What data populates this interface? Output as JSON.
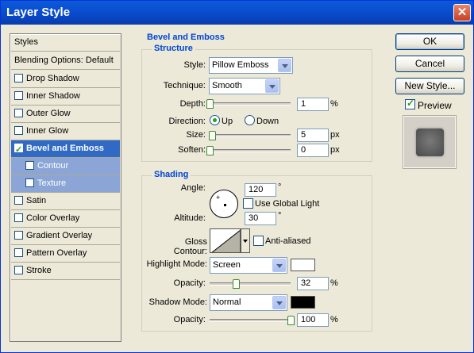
{
  "window": {
    "title": "Layer Style"
  },
  "style_list": {
    "header": "Styles",
    "blending": "Blending Options: Default",
    "items": [
      {
        "label": "Drop Shadow",
        "checked": false
      },
      {
        "label": "Inner Shadow",
        "checked": false
      },
      {
        "label": "Outer Glow",
        "checked": false
      },
      {
        "label": "Inner Glow",
        "checked": false
      },
      {
        "label": "Bevel and Emboss",
        "checked": true,
        "selected": true
      },
      {
        "label": "Contour",
        "checked": false,
        "sub": true
      },
      {
        "label": "Texture",
        "checked": false,
        "sub": true
      },
      {
        "label": "Satin",
        "checked": false
      },
      {
        "label": "Color Overlay",
        "checked": false
      },
      {
        "label": "Gradient Overlay",
        "checked": false
      },
      {
        "label": "Pattern Overlay",
        "checked": false
      },
      {
        "label": "Stroke",
        "checked": false
      }
    ]
  },
  "bevel": {
    "section_title": "Bevel and Emboss",
    "structure": {
      "legend": "Structure",
      "style_label": "Style:",
      "style_value": "Pillow Emboss",
      "technique_label": "Technique:",
      "technique_value": "Smooth",
      "depth_label": "Depth:",
      "depth_value": "1",
      "depth_unit": "%",
      "depth_level": 0.0,
      "direction_label": "Direction:",
      "direction_up": "Up",
      "direction_down": "Down",
      "direction_selected": "Up",
      "size_label": "Size:",
      "size_value": "5",
      "size_unit": "px",
      "size_level": 0.03,
      "soften_label": "Soften:",
      "soften_value": "0",
      "soften_unit": "px",
      "soften_level": 0.0
    },
    "shading": {
      "legend": "Shading",
      "angle_label": "Angle:",
      "angle_value": "120",
      "degree": "°",
      "global_light_label": "Use Global Light",
      "global_light_checked": false,
      "altitude_label": "Altitude:",
      "altitude_value": "30",
      "gloss_label": "Gloss Contour:",
      "anti_aliased_label": "Anti-aliased",
      "anti_aliased_checked": false,
      "highlight_mode_label": "Highlight Mode:",
      "highlight_mode_value": "Screen",
      "highlight_color": "#ffffff",
      "highlight_opacity_label": "Opacity:",
      "highlight_opacity_value": "32",
      "highlight_opacity_unit": "%",
      "highlight_opacity_level": 0.32,
      "shadow_mode_label": "Shadow Mode:",
      "shadow_mode_value": "Normal",
      "shadow_color": "#000000",
      "shadow_opacity_label": "Opacity:",
      "shadow_opacity_value": "100",
      "shadow_opacity_unit": "%",
      "shadow_opacity_level": 1.0
    }
  },
  "buttons": {
    "ok": "OK",
    "cancel": "Cancel",
    "new_style": "New Style...",
    "preview_label": "Preview",
    "preview_checked": true
  },
  "icons": {
    "close": "close-icon",
    "dropdown": "chevron-down-icon",
    "checkbox": "checkmark-icon"
  },
  "colors": {
    "title_bar": "#0a4fd0",
    "selection": "#316ac5",
    "legend_text": "#0046d5"
  }
}
